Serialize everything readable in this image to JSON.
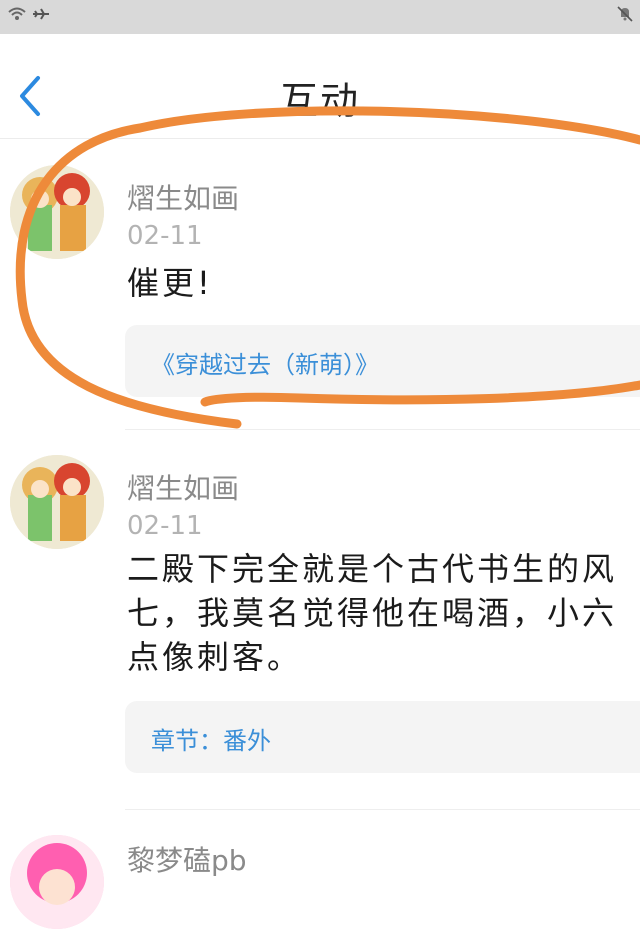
{
  "statusbar": {
    "icons": [
      "wifi-icon",
      "airplane-icon",
      "mute-icon"
    ]
  },
  "header": {
    "title": "互动",
    "back_icon": "chevron-left-icon"
  },
  "colors": {
    "accent": "#3b8fd8",
    "annotation": "#ee8a3a"
  },
  "items": [
    {
      "username": "熠生如画",
      "date": "02-11",
      "content_lines": [
        "催更!"
      ],
      "link": "《穿越过去（新萌）》"
    },
    {
      "username": "熠生如画",
      "date": "02-11",
      "content_lines": [
        "二殿下完全就是个古代书生的风",
        "七，我莫名觉得他在喝酒，小六",
        "点像刺客。"
      ],
      "link": "章节：番外"
    },
    {
      "username": "黎梦磕pb"
    }
  ]
}
